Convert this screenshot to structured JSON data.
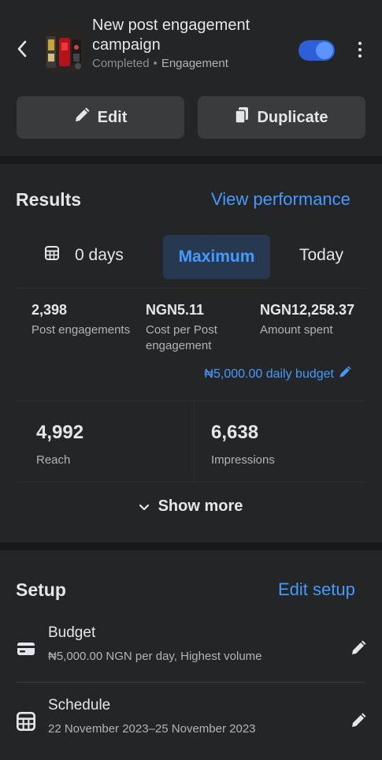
{
  "header": {
    "title": "New post engagement campaign",
    "status": "Completed",
    "category": "Engagement",
    "toggle_on": true
  },
  "actions": {
    "edit_label": "Edit",
    "duplicate_label": "Duplicate"
  },
  "results": {
    "title": "Results",
    "link": "View performance",
    "range": {
      "days": "0 days",
      "maximum": "Maximum",
      "today": "Today"
    },
    "stats": [
      {
        "value": "2,398",
        "label": "Post engagements"
      },
      {
        "value": "NGN5.11",
        "label": "Cost per Post engagement"
      },
      {
        "value": "NGN12,258.37",
        "label": "Amount spent"
      }
    ],
    "daily_budget": "₦5,000.00 daily budget",
    "reach": {
      "value": "4,992",
      "label": "Reach"
    },
    "impressions": {
      "value": "6,638",
      "label": "Impressions"
    },
    "show_more": "Show more"
  },
  "setup": {
    "title": "Setup",
    "link": "Edit setup",
    "rows": [
      {
        "name": "Budget",
        "desc": "₦5,000.00 NGN per day, Highest volume",
        "icon": "credit-card-icon"
      },
      {
        "name": "Schedule",
        "desc": "22 November 2023–25 November 2023",
        "icon": "calendar-icon"
      }
    ]
  },
  "colors": {
    "accent": "#4599ff",
    "toggle": "#2d5fd9",
    "background": "#242526"
  }
}
